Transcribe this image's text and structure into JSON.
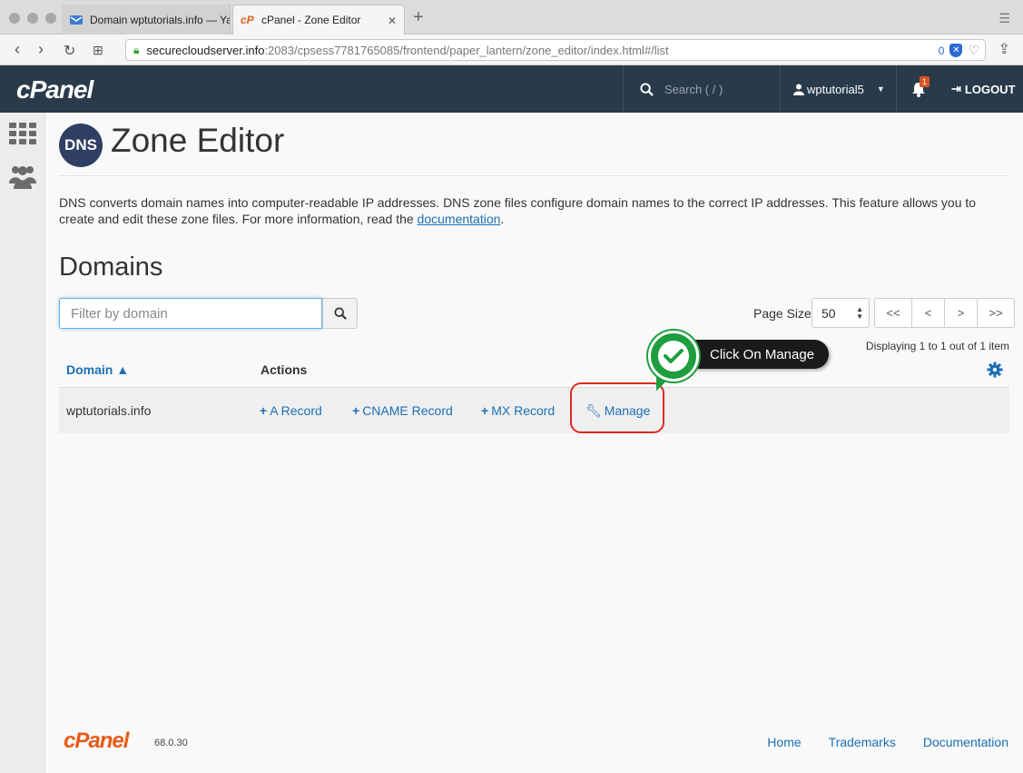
{
  "browser": {
    "tabs": [
      {
        "title": "Domain wptutorials.info — Ya",
        "active": false
      },
      {
        "title": "cPanel - Zone Editor",
        "active": true
      }
    ],
    "url_host": "securecloudserver.info",
    "url_path": ":2083/cpsess7781765085/frontend/paper_lantern/zone_editor/index.html#/list",
    "url_badge_count": "0"
  },
  "header": {
    "logo": "cPanel",
    "search_placeholder": "Search ( / )",
    "username": "wptutorial5",
    "notification_count": "1",
    "logout_label": "LOGOUT"
  },
  "page": {
    "icon_text": "DNS",
    "title": "Zone Editor",
    "description": "DNS converts domain names into computer-readable IP addresses. DNS zone files configure domain names to the correct IP addresses. This feature allows you to create and edit these zone files. For more information, read the ",
    "description_link": "documentation",
    "description_end": "."
  },
  "domains": {
    "section_title": "Domains",
    "filter_placeholder": "Filter by domain",
    "page_size_label": "Page Size",
    "page_size": "50",
    "pager": [
      "<<",
      "<",
      ">",
      ">>"
    ],
    "displaying": "Displaying 1 to 1 out of 1 item",
    "columns": {
      "domain": "Domain",
      "domain_sort": "▲",
      "actions": "Actions"
    },
    "rows": [
      {
        "domain": "wptutorials.info",
        "actions": {
          "a_record": "A Record",
          "cname_record": "CNAME Record",
          "mx_record": "MX Record",
          "manage": "Manage"
        }
      }
    ]
  },
  "callout": {
    "label": "Click On Manage"
  },
  "footer": {
    "logo": "cPanel",
    "version": "68.0.30",
    "links": {
      "home": "Home",
      "trademarks": "Trademarks",
      "documentation": "Documentation"
    }
  },
  "colors": {
    "header_bg": "#293a4a",
    "link": "#1b6fb5",
    "brand_orange": "#e75b18",
    "callout_green": "#1e9e3e",
    "highlight_red": "#e1281e"
  }
}
